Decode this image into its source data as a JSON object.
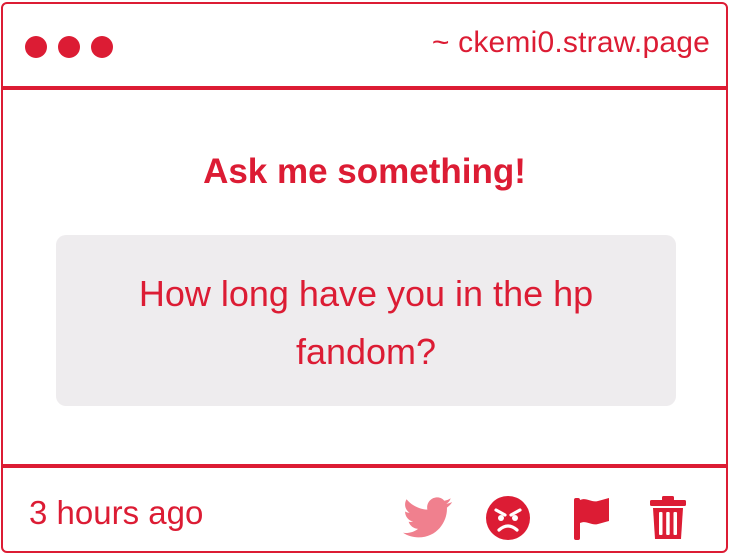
{
  "header": {
    "url_text": "~ ckemi0.straw.page"
  },
  "main": {
    "heading": "Ask me something!",
    "question": "How long have you in the hp fandom?"
  },
  "footer": {
    "timestamp": "3 hours ago",
    "actions": [
      {
        "icon": "twitter-icon"
      },
      {
        "icon": "angry-face-icon"
      },
      {
        "icon": "flag-icon"
      },
      {
        "icon": "trash-icon"
      }
    ]
  },
  "colors": {
    "accent": "#dc1c34",
    "twitter_muted": "#f0808e",
    "question_bg": "#eeecee"
  }
}
